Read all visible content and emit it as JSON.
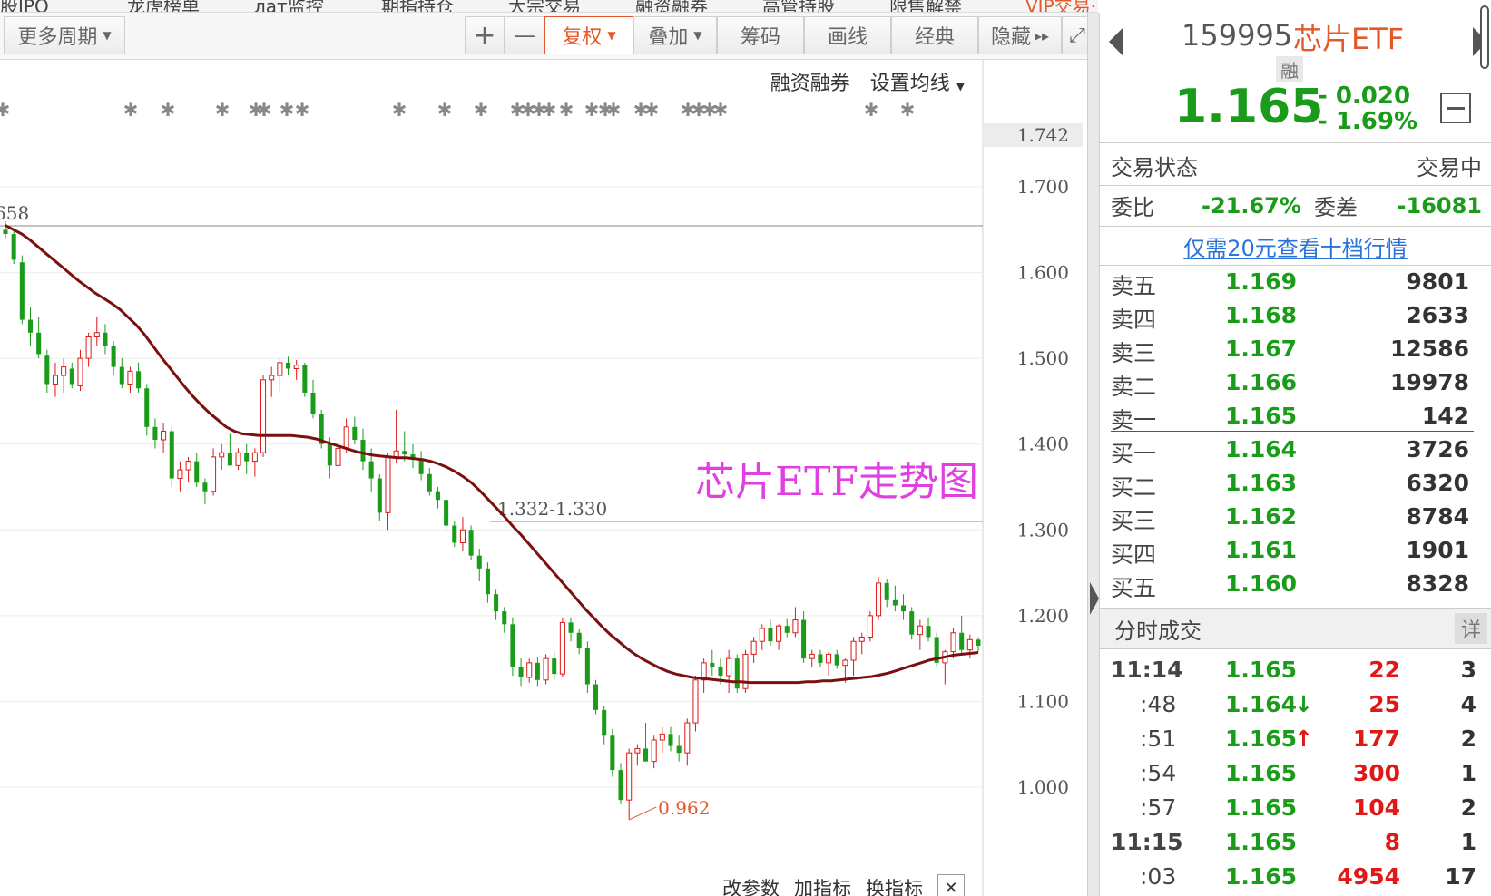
{
  "top_nav": [
    "新股IPO",
    "龙虎榜单",
    "лат监控",
    "期指持仓",
    "大宗交易",
    "融资融券",
    "高管持股",
    "限售解禁",
    "VIP交易·至开通"
  ],
  "toolbar": {
    "period": "更多周期",
    "plus": "+",
    "minus": "—",
    "fuquan": "复权",
    "overlay": "叠加",
    "chouma": "筹码",
    "draw": "画线",
    "classic": "经典",
    "hide": "隐藏",
    "hide_arrow": "▸▸",
    "fullscreen_icon": "expand-icon"
  },
  "chart_options": {
    "margin": "融资融券",
    "ma_setting": "设置均线"
  },
  "chart_footer": {
    "params": "改参数",
    "add_indicator": "加指标",
    "swap_indicator": "换指标",
    "close": "✕"
  },
  "chart_data": {
    "type": "candlestick",
    "title": "芯片ETF走势图",
    "y_ticks": [
      "1.742",
      "1.700",
      "1.600",
      "1.500",
      "1.400",
      "1.300",
      "1.200",
      "1.100",
      "1.000"
    ],
    "ylim": [
      0.94,
      1.75
    ],
    "annotations": {
      "high_line": "658",
      "mid_line": "1.332-1.330",
      "low_mark": "0.962"
    },
    "candles": [
      [
        1.65,
        1.66,
        1.64,
        1.645
      ],
      [
        1.645,
        1.65,
        1.61,
        1.615
      ],
      [
        1.612,
        1.62,
        1.54,
        1.545
      ],
      [
        1.545,
        1.56,
        1.515,
        1.53
      ],
      [
        1.53,
        1.548,
        1.5,
        1.505
      ],
      [
        1.503,
        1.51,
        1.46,
        1.47
      ],
      [
        1.47,
        1.495,
        1.455,
        1.48
      ],
      [
        1.48,
        1.5,
        1.46,
        1.49
      ],
      [
        1.488,
        1.495,
        1.465,
        1.47
      ],
      [
        1.468,
        1.51,
        1.462,
        1.5
      ],
      [
        1.5,
        1.53,
        1.49,
        1.525
      ],
      [
        1.525,
        1.548,
        1.515,
        1.53
      ],
      [
        1.53,
        1.54,
        1.505,
        1.515
      ],
      [
        1.515,
        1.52,
        1.48,
        1.49
      ],
      [
        1.49,
        1.5,
        1.465,
        1.47
      ],
      [
        1.47,
        1.49,
        1.46,
        1.485
      ],
      [
        1.485,
        1.495,
        1.46,
        1.465
      ],
      [
        1.465,
        1.47,
        1.41,
        1.42
      ],
      [
        1.42,
        1.43,
        1.395,
        1.405
      ],
      [
        1.405,
        1.425,
        1.39,
        1.415
      ],
      [
        1.415,
        1.42,
        1.35,
        1.36
      ],
      [
        1.36,
        1.38,
        1.345,
        1.37
      ],
      [
        1.37,
        1.385,
        1.355,
        1.38
      ],
      [
        1.38,
        1.39,
        1.35,
        1.355
      ],
      [
        1.355,
        1.36,
        1.33,
        1.345
      ],
      [
        1.345,
        1.395,
        1.34,
        1.385
      ],
      [
        1.385,
        1.4,
        1.37,
        1.39
      ],
      [
        1.39,
        1.412,
        1.378,
        1.375
      ],
      [
        1.375,
        1.395,
        1.37,
        1.39
      ],
      [
        1.39,
        1.4,
        1.365,
        1.38
      ],
      [
        1.38,
        1.395,
        1.362,
        1.39
      ],
      [
        1.39,
        1.48,
        1.385,
        1.475
      ],
      [
        1.475,
        1.49,
        1.455,
        1.48
      ],
      [
        1.48,
        1.5,
        1.46,
        1.495
      ],
      [
        1.495,
        1.502,
        1.48,
        1.488
      ],
      [
        1.488,
        1.498,
        1.475,
        1.492
      ],
      [
        1.492,
        1.495,
        1.455,
        1.46
      ],
      [
        1.46,
        1.475,
        1.43,
        1.435
      ],
      [
        1.435,
        1.44,
        1.395,
        1.4
      ],
      [
        1.4,
        1.408,
        1.36,
        1.375
      ],
      [
        1.375,
        1.4,
        1.34,
        1.395
      ],
      [
        1.395,
        1.43,
        1.39,
        1.42
      ],
      [
        1.42,
        1.432,
        1.4,
        1.405
      ],
      [
        1.405,
        1.418,
        1.37,
        1.38
      ],
      [
        1.38,
        1.395,
        1.345,
        1.36
      ],
      [
        1.36,
        1.365,
        1.31,
        1.32
      ],
      [
        1.32,
        1.39,
        1.3,
        1.385
      ],
      [
        1.385,
        1.44,
        1.378,
        1.392
      ],
      [
        1.392,
        1.415,
        1.38,
        1.388
      ],
      [
        1.388,
        1.4,
        1.372,
        1.382
      ],
      [
        1.382,
        1.392,
        1.358,
        1.365
      ],
      [
        1.365,
        1.372,
        1.34,
        1.345
      ],
      [
        1.345,
        1.35,
        1.325,
        1.335
      ],
      [
        1.335,
        1.34,
        1.3,
        1.305
      ],
      [
        1.305,
        1.31,
        1.28,
        1.285
      ],
      [
        1.285,
        1.315,
        1.275,
        1.3
      ],
      [
        1.3,
        1.305,
        1.265,
        1.27
      ],
      [
        1.27,
        1.278,
        1.24,
        1.255
      ],
      [
        1.255,
        1.262,
        1.215,
        1.225
      ],
      [
        1.225,
        1.23,
        1.195,
        1.205
      ],
      [
        1.205,
        1.21,
        1.18,
        1.19
      ],
      [
        1.19,
        1.198,
        1.13,
        1.14
      ],
      [
        1.14,
        1.15,
        1.118,
        1.128
      ],
      [
        1.128,
        1.15,
        1.122,
        1.145
      ],
      [
        1.145,
        1.152,
        1.118,
        1.125
      ],
      [
        1.125,
        1.155,
        1.12,
        1.15
      ],
      [
        1.15,
        1.158,
        1.125,
        1.132
      ],
      [
        1.132,
        1.198,
        1.128,
        1.192
      ],
      [
        1.192,
        1.198,
        1.17,
        1.18
      ],
      [
        1.18,
        1.184,
        1.155,
        1.162
      ],
      [
        1.162,
        1.17,
        1.11,
        1.12
      ],
      [
        1.12,
        1.125,
        1.085,
        1.09
      ],
      [
        1.09,
        1.095,
        1.05,
        1.06
      ],
      [
        1.06,
        1.068,
        1.012,
        1.02
      ],
      [
        1.02,
        1.028,
        0.98,
        0.985
      ],
      [
        0.985,
        1.045,
        0.962,
        1.04
      ],
      [
        1.04,
        1.05,
        1.025,
        1.045
      ],
      [
        1.045,
        1.075,
        1.03,
        1.03
      ],
      [
        1.03,
        1.06,
        1.022,
        1.055
      ],
      [
        1.055,
        1.07,
        1.04,
        1.062
      ],
      [
        1.062,
        1.07,
        1.042,
        1.048
      ],
      [
        1.048,
        1.06,
        1.03,
        1.04
      ],
      [
        1.04,
        1.08,
        1.025,
        1.075
      ],
      [
        1.075,
        1.13,
        1.065,
        1.125
      ],
      [
        1.125,
        1.15,
        1.11,
        1.145
      ],
      [
        1.145,
        1.16,
        1.13,
        1.14
      ],
      [
        1.14,
        1.15,
        1.12,
        1.13
      ],
      [
        1.13,
        1.16,
        1.11,
        1.15
      ],
      [
        1.15,
        1.155,
        1.11,
        1.115
      ],
      [
        1.115,
        1.16,
        1.11,
        1.155
      ],
      [
        1.155,
        1.175,
        1.145,
        1.17
      ],
      [
        1.17,
        1.19,
        1.16,
        1.185
      ],
      [
        1.185,
        1.195,
        1.165,
        1.17
      ],
      [
        1.17,
        1.19,
        1.16,
        1.188
      ],
      [
        1.188,
        1.196,
        1.175,
        1.18
      ],
      [
        1.18,
        1.21,
        1.175,
        1.195
      ],
      [
        1.195,
        1.205,
        1.145,
        1.15
      ],
      [
        1.15,
        1.16,
        1.14,
        1.155
      ],
      [
        1.155,
        1.16,
        1.14,
        1.145
      ],
      [
        1.145,
        1.158,
        1.13,
        1.155
      ],
      [
        1.155,
        1.16,
        1.138,
        1.142
      ],
      [
        1.142,
        1.15,
        1.122,
        1.148
      ],
      [
        1.148,
        1.175,
        1.13,
        1.17
      ],
      [
        1.17,
        1.18,
        1.155,
        1.175
      ],
      [
        1.175,
        1.205,
        1.17,
        1.2
      ],
      [
        1.2,
        1.245,
        1.195,
        1.238
      ],
      [
        1.238,
        1.242,
        1.21,
        1.218
      ],
      [
        1.218,
        1.235,
        1.205,
        1.212
      ],
      [
        1.212,
        1.225,
        1.195,
        1.205
      ],
      [
        1.205,
        1.21,
        1.172,
        1.178
      ],
      [
        1.178,
        1.195,
        1.16,
        1.188
      ],
      [
        1.188,
        1.198,
        1.17,
        1.175
      ],
      [
        1.175,
        1.18,
        1.14,
        1.145
      ],
      [
        1.145,
        1.16,
        1.12,
        1.158
      ],
      [
        1.158,
        1.185,
        1.15,
        1.18
      ],
      [
        1.18,
        1.2,
        1.155,
        1.16
      ],
      [
        1.16,
        1.178,
        1.15,
        1.172
      ],
      [
        1.172,
        1.175,
        1.158,
        1.165
      ]
    ],
    "ma_line": [
      1.655,
      1.65,
      1.645,
      1.638,
      1.63,
      1.622,
      1.614,
      1.606,
      1.598,
      1.59,
      1.583,
      1.576,
      1.57,
      1.564,
      1.557,
      1.548,
      1.539,
      1.528,
      1.515,
      1.502,
      1.49,
      1.478,
      1.466,
      1.455,
      1.445,
      1.436,
      1.428,
      1.42,
      1.415,
      1.412,
      1.411,
      1.41,
      1.41,
      1.41,
      1.41,
      1.41,
      1.409,
      1.408,
      1.406,
      1.403,
      1.4,
      1.397,
      1.394,
      1.391,
      1.389,
      1.387,
      1.386,
      1.385,
      1.384,
      1.384,
      1.383,
      1.382,
      1.38,
      1.377,
      1.373,
      1.368,
      1.362,
      1.355,
      1.346,
      1.336,
      1.326,
      1.316,
      1.305,
      1.295,
      1.284,
      1.273,
      1.262,
      1.251,
      1.24,
      1.229,
      1.218,
      1.207,
      1.197,
      1.187,
      1.178,
      1.17,
      1.162,
      1.155,
      1.149,
      1.144,
      1.139,
      1.135,
      1.132,
      1.13,
      1.128,
      1.127,
      1.126,
      1.125,
      1.124,
      1.123,
      1.123,
      1.122,
      1.122,
      1.122,
      1.122,
      1.122,
      1.122,
      1.122,
      1.123,
      1.123,
      1.124,
      1.124,
      1.125,
      1.126,
      1.127,
      1.128,
      1.129,
      1.131,
      1.133,
      1.136,
      1.139,
      1.142,
      1.145,
      1.148,
      1.15,
      1.152,
      1.154,
      1.155,
      1.156,
      1.157
    ],
    "grid": true
  },
  "quote": {
    "code": "159995",
    "name": "芯片ETF",
    "badge": "融",
    "price": "1.165",
    "change": "- 0.020",
    "change_pct": "- 1.69%",
    "status_label": "交易状态",
    "status_value": "交易中",
    "weibi_label": "委比",
    "weibi_value": "-21.67%",
    "weicha_label": "委差",
    "weicha_value": "-16081",
    "promo": "仅需20元查看十档行情",
    "colors": {
      "up": "#e01818",
      "down": "#1a9c1a",
      "accent": "#e2592b"
    }
  },
  "order_book": {
    "asks": [
      {
        "label": "卖五",
        "price": "1.169",
        "volume": "9801"
      },
      {
        "label": "卖四",
        "price": "1.168",
        "volume": "2633"
      },
      {
        "label": "卖三",
        "price": "1.167",
        "volume": "12586"
      },
      {
        "label": "卖二",
        "price": "1.166",
        "volume": "19978"
      },
      {
        "label": "卖一",
        "price": "1.165",
        "volume": "142"
      }
    ],
    "bids": [
      {
        "label": "买一",
        "price": "1.164",
        "volume": "3726"
      },
      {
        "label": "买二",
        "price": "1.163",
        "volume": "6320"
      },
      {
        "label": "买三",
        "price": "1.162",
        "volume": "8784"
      },
      {
        "label": "买四",
        "price": "1.161",
        "volume": "1901"
      },
      {
        "label": "买五",
        "price": "1.160",
        "volume": "8328"
      }
    ]
  },
  "ticks": {
    "title": "分时成交",
    "detail": "详",
    "rows": [
      {
        "time": "11:14",
        "price": "1.165",
        "arrow": "",
        "volume": "22",
        "count": "3"
      },
      {
        "time": ":48",
        "price": "1.164",
        "arrow": "down",
        "volume": "25",
        "count": "4"
      },
      {
        "time": ":51",
        "price": "1.165",
        "arrow": "up",
        "volume": "177",
        "count": "2"
      },
      {
        "time": ":54",
        "price": "1.165",
        "arrow": "",
        "volume": "300",
        "count": "1"
      },
      {
        "time": ":57",
        "price": "1.165",
        "arrow": "",
        "volume": "104",
        "count": "2"
      },
      {
        "time": "11:15",
        "price": "1.165",
        "arrow": "",
        "volume": "8",
        "count": "1"
      },
      {
        "time": ":03",
        "price": "1.165",
        "arrow": "",
        "volume": "4954",
        "count": "17"
      }
    ]
  }
}
